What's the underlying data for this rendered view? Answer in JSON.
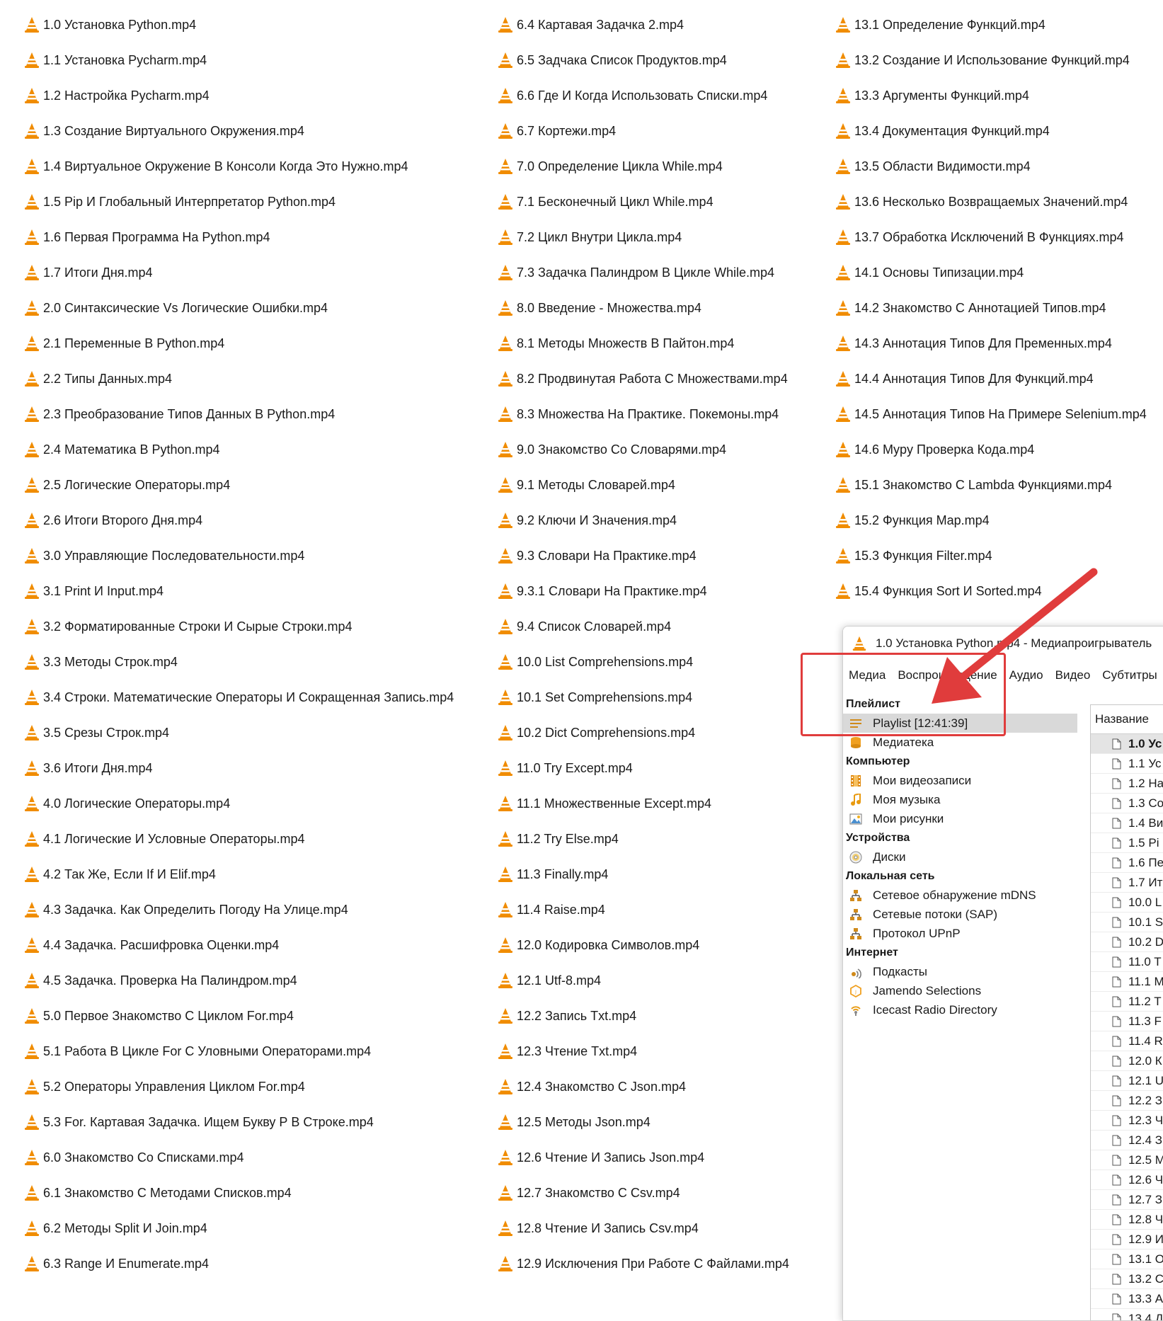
{
  "file_columns": [
    [
      "1.0 Установка Python.mp4",
      "1.1 Установка Pycharm.mp4",
      "1.2 Настройка Pycharm.mp4",
      "1.3 Создание Виртуального Окружения.mp4",
      "1.4 Виртуальное Окружение В Консоли Когда Это Нужно.mp4",
      "1.5 Pip И Глобальный Интерпретатор Python.mp4",
      "1.6 Первая Программа На Python.mp4",
      "1.7 Итоги Дня.mp4",
      "2.0 Синтаксические Vs Логические Ошибки.mp4",
      "2.1 Переменные В Python.mp4",
      "2.2 Типы Данных.mp4",
      "2.3 Преобразование Типов Данных В Python.mp4",
      "2.4 Математика В Python.mp4",
      "2.5 Логические Операторы.mp4",
      "2.6 Итоги Второго Дня.mp4",
      "3.0 Управляющие Последовательности.mp4",
      "3.1 Print И Input.mp4",
      "3.2 Форматированные Строки И Сырые Строки.mp4",
      "3.3 Методы Строк.mp4",
      "3.4 Строки. Математические Операторы И Сокращенная Запись.mp4",
      "3.5 Срезы Строк.mp4",
      "3.6 Итоги Дня.mp4",
      "4.0 Логические Операторы.mp4",
      "4.1 Логические И Условные Операторы.mp4",
      "4.2 Так Же, Если If И Elif.mp4",
      "4.3 Задачка. Как Определить Погоду На Улице.mp4",
      "4.4 Задачка. Расшифровка Оценки.mp4",
      "4.5 Задачка. Проверка На Палиндром.mp4",
      "5.0 Первое Знакомство С Циклом For.mp4",
      "5.1 Работа В Цикле For С Уловными Операторами.mp4",
      "5.2 Операторы Управления Циклом For.mp4",
      "5.3 For. Картавая Задачка. Ищем Букву Р В Строке.mp4",
      "6.0 Знакомство Со Списками.mp4",
      "6.1 Знакомство С Методами Списков.mp4",
      "6.2 Методы Split И Join.mp4",
      "6.3 Range И Enumerate.mp4"
    ],
    [
      "6.4 Картавая Задачка 2.mp4",
      "6.5 Задчака Список Продуктов.mp4",
      "6.6 Где И Когда Использовать Списки.mp4",
      "6.7 Кортежи.mp4",
      "7.0 Определение Цикла While.mp4",
      "7.1 Бесконечный Цикл While.mp4",
      "7.2 Цикл Внутри Цикла.mp4",
      "7.3 Задачка Палиндром В Цикле While.mp4",
      "8.0 Введение - Множества.mp4",
      "8.1 Методы Множеств В Пайтон.mp4",
      "8.2 Продвинутая Работа С Множествами.mp4",
      "8.3 Множества На Практике. Покемоны.mp4",
      "9.0 Знакомство Со Словарями.mp4",
      "9.1 Методы Словарей.mp4",
      "9.2 Ключи И Значения.mp4",
      "9.3 Словари На Практике.mp4",
      "9.3.1 Словари На Практике.mp4",
      "9.4 Список Словарей.mp4",
      "10.0 List Comprehensions.mp4",
      "10.1 Set Comprehensions.mp4",
      "10.2 Dict Comprehensions.mp4",
      "11.0 Try Except.mp4",
      "11.1 Множественные Except.mp4",
      "11.2 Try Else.mp4",
      "11.3 Finally.mp4",
      "11.4 Raise.mp4",
      "12.0 Кодировка Символов.mp4",
      "12.1 Utf-8.mp4",
      "12.2 Запись Txt.mp4",
      "12.3 Чтение Txt.mp4",
      "12.4 Знакомство С Json.mp4",
      "12.5 Методы Json.mp4",
      "12.6 Чтение И Запись Json.mp4",
      "12.7 Знакомство С Csv.mp4",
      "12.8 Чтение И Запись Csv.mp4",
      "12.9 Исключения При Работе С Файлами.mp4"
    ],
    [
      "13.1 Определение Функций.mp4",
      "13.2 Создание И Использование Функций.mp4",
      "13.3 Аргументы Функций.mp4",
      "13.4 Документация Функций.mp4",
      "13.5 Области Видимости.mp4",
      "13.6 Несколько Возвращаемых Значений.mp4",
      "13.7 Обработка Исключений В Функциях.mp4",
      "14.1 Основы Типизации.mp4",
      "14.2 Знакомство С Аннотацией Типов.mp4",
      "14.3 Аннотация Типов Для Пременных.mp4",
      "14.4 Аннотация Типов Для Функций.mp4",
      "14.5 Аннотация Типов На Примере Selenium.mp4",
      "14.6 Mypy Проверка Кода.mp4",
      "15.1 Знакомство С Lambda Функциями.mp4",
      "15.2 Функция Map.mp4",
      "15.3 Функция Filter.mp4",
      "15.4 Функция Sort И Sorted.mp4"
    ]
  ],
  "vlc": {
    "title": "1.0 Установка Python.mp4 - Медиапроигрыватель",
    "menu": [
      "Медиа",
      "Воспроизведение",
      "Аудио",
      "Видео",
      "Субтитры"
    ],
    "sections": [
      {
        "header": "Плейлист",
        "items": [
          {
            "label": "Playlist [12:41:39]",
            "icon": "playlist-icon",
            "selected": true
          },
          {
            "label": "Медиатека",
            "icon": "library-icon"
          }
        ]
      },
      {
        "header": "Компьютер",
        "items": [
          {
            "label": "Мои видеозаписи",
            "icon": "film-icon"
          },
          {
            "label": "Моя музыка",
            "icon": "music-note-icon"
          },
          {
            "label": "Мои рисунки",
            "icon": "picture-icon"
          }
        ]
      },
      {
        "header": "Устройства",
        "items": [
          {
            "label": "Диски",
            "icon": "disc-icon"
          }
        ]
      },
      {
        "header": "Локальная сеть",
        "items": [
          {
            "label": "Сетевое обнаружение mDNS",
            "icon": "network-icon"
          },
          {
            "label": "Сетевые потоки (SAP)",
            "icon": "network-icon"
          },
          {
            "label": "Протокол UPnP",
            "icon": "network-icon"
          }
        ]
      },
      {
        "header": "Интернет",
        "items": [
          {
            "label": "Подкасты",
            "icon": "podcast-icon"
          },
          {
            "label": "Jamendo Selections",
            "icon": "jamendo-icon"
          },
          {
            "label": "Icecast Radio Directory",
            "icon": "radio-icon"
          }
        ]
      }
    ],
    "playlist_header": "Название",
    "playlist_rows": [
      "1.0 Ус",
      "1.1 Ус",
      "1.2 На",
      "1.3 Со",
      "1.4 Ви",
      "1.5 Pi",
      "1.6 Пе",
      "1.7 Ит",
      "10.0 L",
      "10.1 S",
      "10.2 D",
      "11.0 T",
      "11.1 M",
      "11.2 T",
      "11.3 F",
      "11.4 R",
      "12.0 К",
      "12.1 U",
      "12.2 З",
      "12.3 Ч",
      "12.4 З",
      "12.5 М",
      "12.6 Ч",
      "12.7 З",
      "12.8 Ч",
      "12.9 И",
      "13.1 О",
      "13.2 С",
      "13.3 А",
      "13.4 Д"
    ],
    "playlist_current_index": 0
  },
  "colors": {
    "cone_orange": "#f08c00",
    "cone_stripe": "#ffffff",
    "annotation_red": "#e03c3c"
  }
}
